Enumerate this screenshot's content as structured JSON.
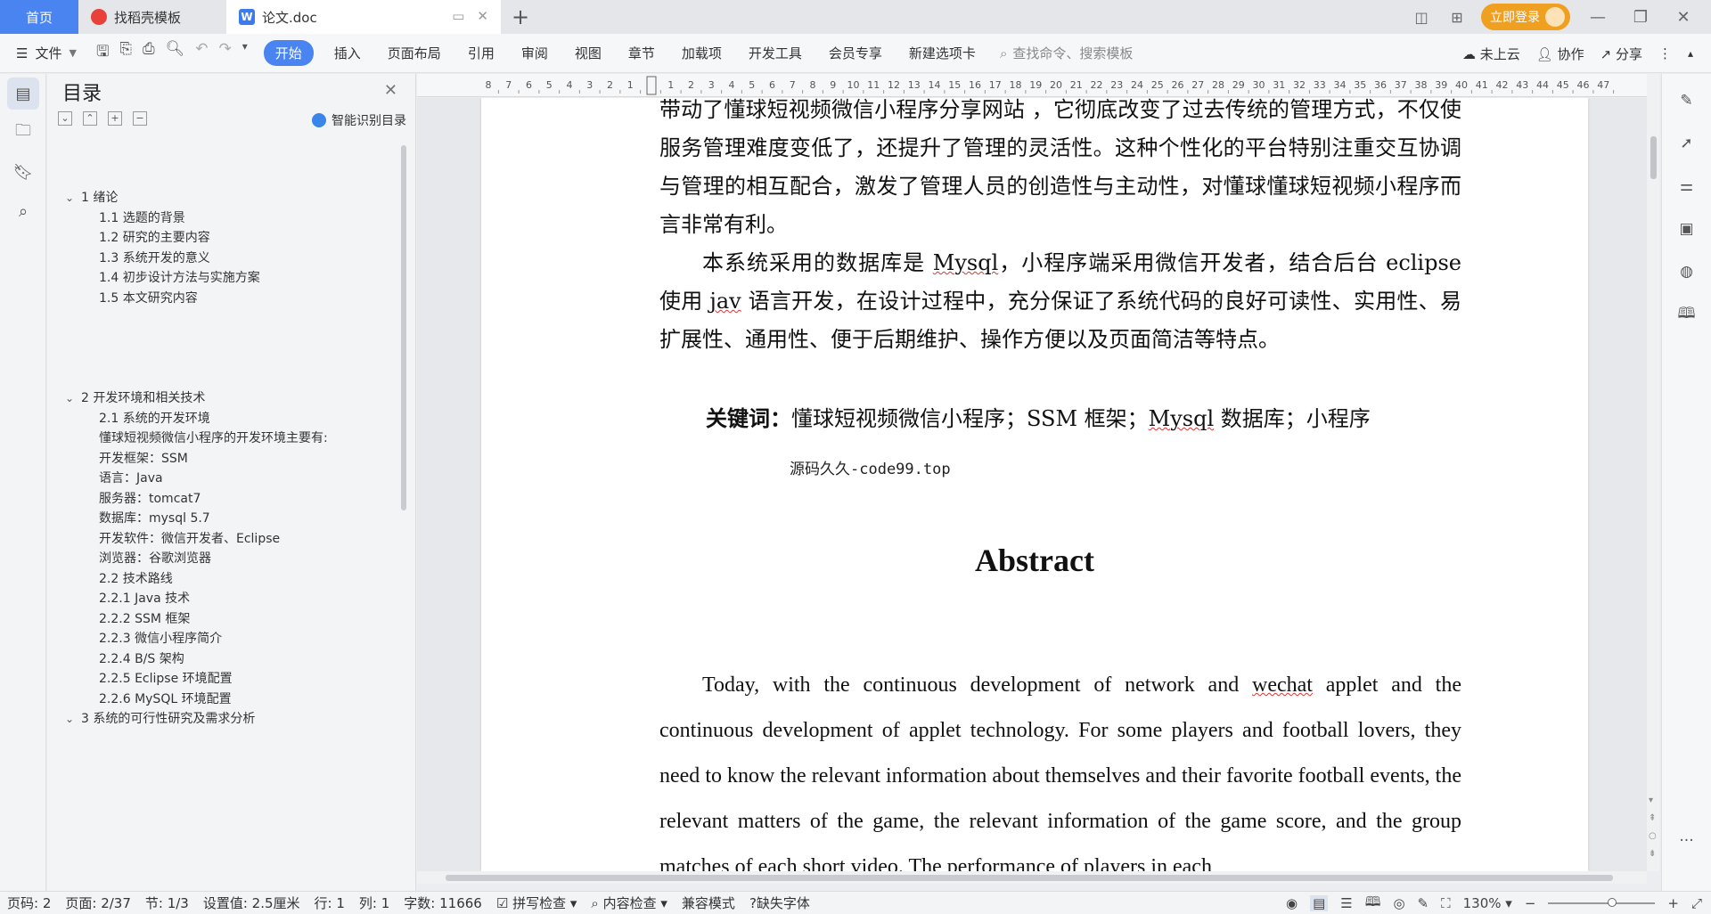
{
  "tabs": {
    "home": "首页",
    "template": "找稻壳模板",
    "document": "论文.doc"
  },
  "titlebar": {
    "login_button": "立即登录"
  },
  "ribbon": {
    "file_menu": "文件",
    "tabs": [
      "开始",
      "插入",
      "页面布局",
      "引用",
      "审阅",
      "视图",
      "章节",
      "加载项",
      "开发工具",
      "会员专享",
      "新建选项卡"
    ],
    "active_tab": "开始",
    "search_placeholder": "查找命令、搜索模板",
    "cloud_status": "未上云",
    "collaborate": "协作",
    "share": "分享"
  },
  "toc": {
    "title": "目录",
    "smart_button": "智能识别目录",
    "items": [
      {
        "level": 1,
        "text": "1 绪论",
        "expanded": true
      },
      {
        "level": 2,
        "text": "1.1 选题的背景"
      },
      {
        "level": 2,
        "text": "1.2  研究的主要内容"
      },
      {
        "level": 2,
        "text": "1.3  系统开发的意义"
      },
      {
        "level": 2,
        "text": "1.4 初步设计方法与实施方案"
      },
      {
        "level": 2,
        "text": "1.5  本文研究内容"
      },
      {
        "level": 1,
        "text": "2 开发环境和相关技术",
        "expanded": true
      },
      {
        "level": 2,
        "text": "2.1 系统的开发环境"
      },
      {
        "level": 2,
        "text": "懂球短视频微信小程序的开发环境主要有:"
      },
      {
        "level": 2,
        "text": "开发框架：SSM"
      },
      {
        "level": 2,
        "text": "语言：Java"
      },
      {
        "level": 2,
        "text": "服务器：tomcat7"
      },
      {
        "level": 2,
        "text": "数据库：mysql 5.7"
      },
      {
        "level": 2,
        "text": "开发软件：微信开发者、Eclipse"
      },
      {
        "level": 2,
        "text": "浏览器：谷歌浏览器"
      },
      {
        "level": 2,
        "text": "2.2 技术路线"
      },
      {
        "level": 2,
        "text": "2.2.1 Java 技术"
      },
      {
        "level": 2,
        "text": "2.2.2 SSM 框架"
      },
      {
        "level": 2,
        "text": "2.2.3 微信小程序简介"
      },
      {
        "level": 2,
        "text": "2.2.4 B/S 架构"
      },
      {
        "level": 2,
        "text": "2.2.5 Eclipse 环境配置"
      },
      {
        "level": 2,
        "text": "2.2.6 MySQL 环境配置"
      },
      {
        "level": 1,
        "text": "3 系统的可行性研究及需求分析",
        "expanded": true
      }
    ]
  },
  "ruler": {
    "ticks": [
      "8",
      "7",
      "6",
      "5",
      "4",
      "3",
      "2",
      "1",
      "",
      "1",
      "2",
      "3",
      "4",
      "5",
      "6",
      "7",
      "8",
      "9",
      "10",
      "11",
      "12",
      "13",
      "14",
      "15",
      "16",
      "17",
      "18",
      "19",
      "20",
      "21",
      "22",
      "23",
      "24",
      "25",
      "26",
      "27",
      "28",
      "29",
      "30",
      "31",
      "32",
      "33",
      "34",
      "35",
      "36",
      "37",
      "38",
      "39",
      "40",
      "41",
      "42",
      "43",
      "44",
      "45",
      "46",
      "47"
    ]
  },
  "document": {
    "zh_paragraph_1": "带动了懂球短视频微信小程序分享网站 ，它彻底改变了过去传统的管理方式，不仅使服务管理难度变低了，还提升了管理的灵活性。这种个性化的平台特别注重交互协调与管理的相互配合，激发了管理人员的创造性与主动性，对懂球懂球短视频小程序而言非常有利。",
    "zh_paragraph_2_a": "本系统采用的数据库是 ",
    "zh_mysql": "Mysql",
    "zh_paragraph_2_b": "，小程序端采用微信开发者，结合后台 eclipse 使用 ",
    "zh_jav": "jav",
    "zh_paragraph_2_c": " 语言开发，在设计过程中，充分保证了系统代码的良好可读性、实用性、易扩展性、通用性、便于后期维护、操作方便以及页面简洁等特点。",
    "keywords_label": "关键词：",
    "keywords_a": "懂球短视频微信小程序；SSM 框架；",
    "keywords_mysql": "Mysql",
    "keywords_b": " 数据库；小程序",
    "watermark": "源码久久-code99.top",
    "abstract_title": "Abstract",
    "en_a": "Today, with the continuous development of network and ",
    "en_wechat": "wechat",
    "en_b": " applet and the continuous development of applet technology. For some players and football lovers, they need to know the relevant information about themselves and their favorite football events, the relevant matters of the game, the relevant information of the game score, and the group matches of each short video. The performance of players in each"
  },
  "statusbar": {
    "page_code": "页码: 2",
    "page": "页面: 2/37",
    "section": "节: 1/3",
    "setting": "设置值: 2.5厘米",
    "row": "行: 1",
    "column": "列: 1",
    "word_count": "字数: 11666",
    "spell_check": "拼写检查",
    "content_check": "内容检查",
    "compat_mode": "兼容模式",
    "missing_font": "缺失字体",
    "zoom": "130%",
    "zoom_level": 0.6
  }
}
